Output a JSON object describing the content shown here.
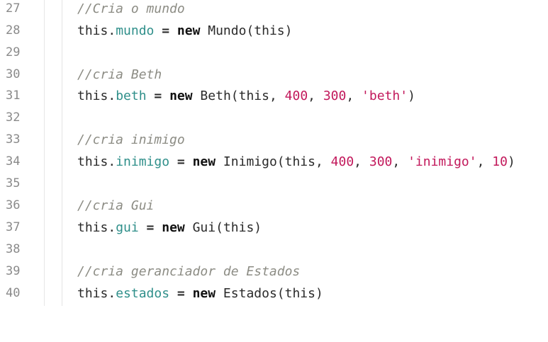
{
  "colors": {
    "background": "#ffffff",
    "line_number": "#8a8a8a",
    "comment": "#8c8c84",
    "property": "#2f8f8a",
    "literal": "#c2185b",
    "text": "#2a2a2a"
  },
  "lines": [
    {
      "number": "27",
      "comment": "//Cria o mundo"
    },
    {
      "number": "28",
      "this": "this",
      "dot": ".",
      "prop": "mundo",
      "eq": " = ",
      "new": "new",
      "cls": " Mundo(this)"
    },
    {
      "number": "29"
    },
    {
      "number": "30",
      "comment": "//cria Beth"
    },
    {
      "number": "31",
      "this": "this",
      "dot": ".",
      "prop": "beth",
      "eq": " = ",
      "new": "new",
      "cls": " Beth(this, ",
      "a1": "400",
      "s1": ", ",
      "a2": "300",
      "s2": ", ",
      "a3": "'beth'",
      "end": ")"
    },
    {
      "number": "32"
    },
    {
      "number": "33",
      "comment": "//cria inimigo"
    },
    {
      "number": "34",
      "this": "this",
      "dot": ".",
      "prop": "inimigo",
      "eq": " = ",
      "new": "new",
      "cls": " Inimigo(this, ",
      "a1": "400",
      "s1": ", ",
      "a2": "300",
      "s2": ", ",
      "a3": "'inimigo'",
      "s3": ", ",
      "a4": "10",
      "end": ")"
    },
    {
      "number": "35"
    },
    {
      "number": "36",
      "comment": "//cria Gui"
    },
    {
      "number": "37",
      "this": "this",
      "dot": ".",
      "prop": "gui",
      "eq": " = ",
      "new": "new",
      "cls": " Gui(this)"
    },
    {
      "number": "38"
    },
    {
      "number": "39",
      "comment": "//cria geranciador de Estados"
    },
    {
      "number": "40",
      "this": "this",
      "dot": ".",
      "prop": "estados",
      "eq": " = ",
      "new": "new",
      "cls": " Estados(this)"
    }
  ]
}
